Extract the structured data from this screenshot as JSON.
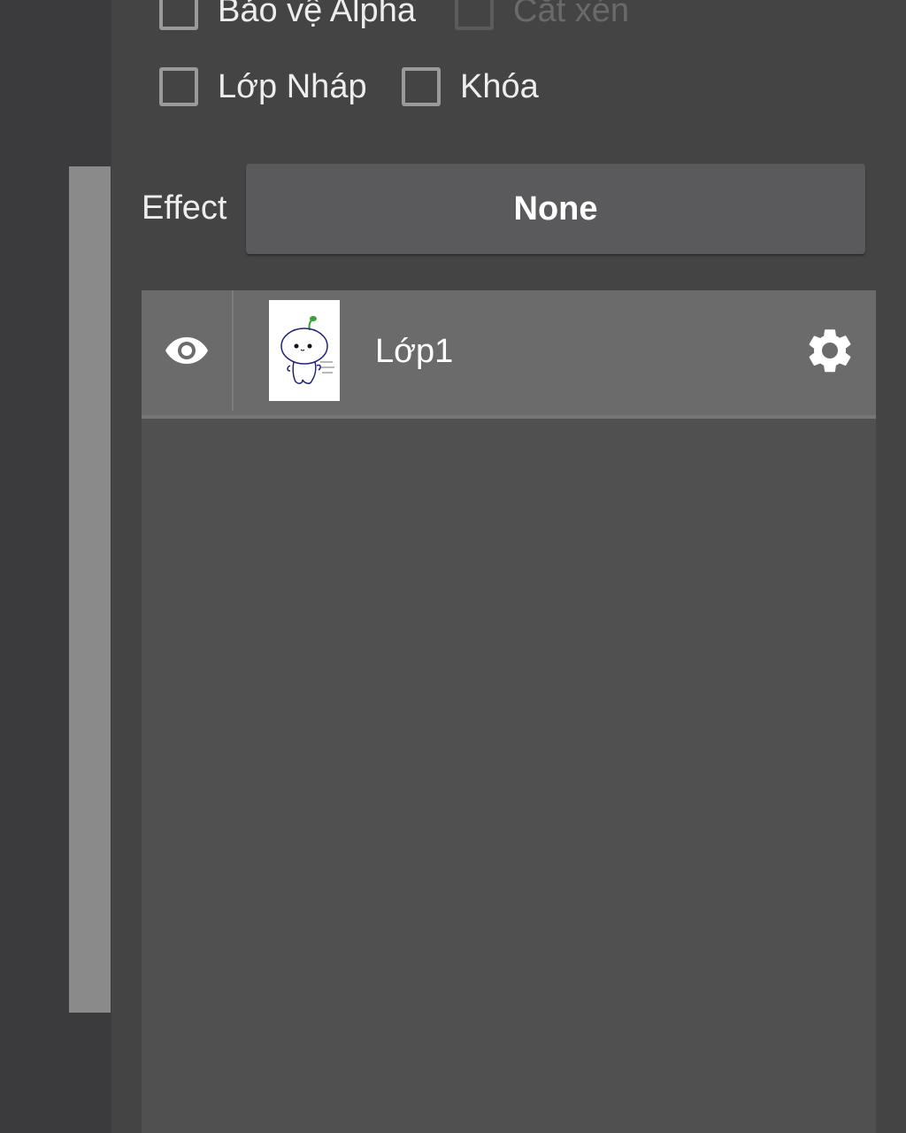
{
  "options": {
    "alpha_protect_label": "Bảo vệ Alpha",
    "clipping_label": "Cắt xén",
    "draft_layer_label": "Lớp Nháp",
    "lock_label": "Khóa"
  },
  "effect": {
    "label": "Effect",
    "value": "None"
  },
  "layers": [
    {
      "name": "Lớp1",
      "visible": true
    }
  ],
  "icons": {
    "visibility": "eye-icon",
    "settings": "gear-icon"
  },
  "colors": {
    "panel_bg": "#444444",
    "layer_row_bg": "#6b6b6b",
    "list_bg": "#505050",
    "button_bg": "#5a5a5c"
  }
}
